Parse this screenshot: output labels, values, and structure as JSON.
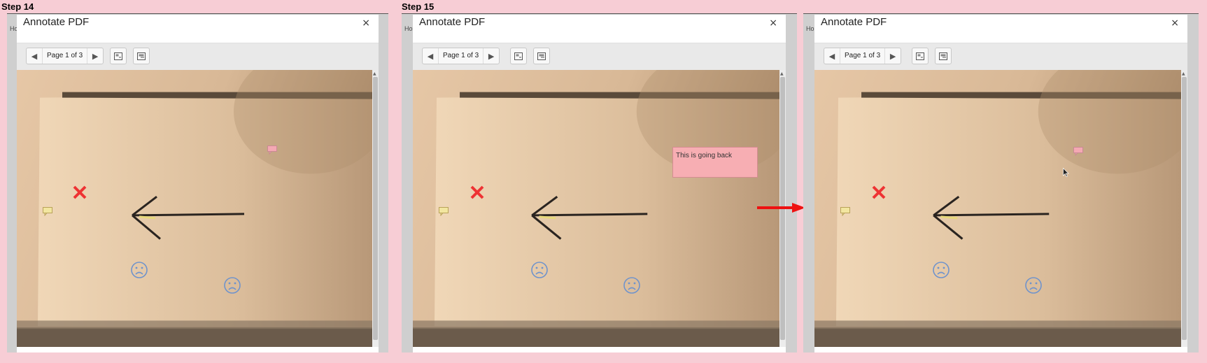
{
  "steps": {
    "step14": "Step 14",
    "step15": "Step 15"
  },
  "dialog": {
    "title": "Annotate PDF",
    "close": "×",
    "home_tab": "Ho",
    "page_indicator": "Page 1 of 3",
    "prev_icon": "◀",
    "next_icon": "▶"
  },
  "note": {
    "text": "This is going back"
  },
  "colors": {
    "background": "#f7cdd5",
    "arrow": "#ee1111",
    "note": "#f7aeb3",
    "x_mark": "#ee3333",
    "smiley": "#6f93cc"
  },
  "icons": [
    "prev-page-icon",
    "next-page-icon",
    "fit-page-icon",
    "fit-width-icon",
    "close-icon",
    "speech-bubble-icon",
    "x-mark-icon",
    "sad-face-icon",
    "mouse-cursor-icon",
    "right-arrow-icon"
  ]
}
